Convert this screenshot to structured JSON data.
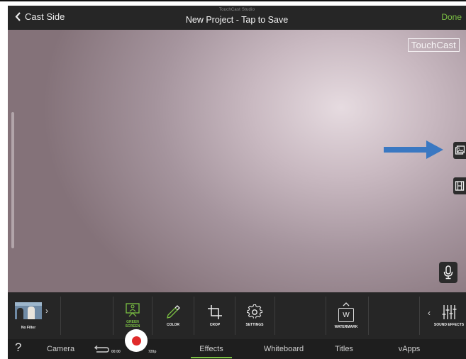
{
  "header": {
    "back_label": "Cast Side",
    "studio_label": "TouchCast Studio",
    "project_title": "New Project - Tap to Save",
    "done_label": "Done"
  },
  "canvas": {
    "logo_text": "TouchCast"
  },
  "effects_bar": {
    "filter_label": "No Filter",
    "green_screen_label": "GREEN\nSCREEN",
    "color_label": "COLOR",
    "crop_label": "CROP",
    "settings_label": "SETTINGS",
    "watermark_label": "WATERMARK",
    "watermark_glyph": "W",
    "sound_effects_label": "SOUND EFFECTS"
  },
  "bottom_bar": {
    "help_label": "?",
    "camera_label": "Camera",
    "timer": "00:00",
    "resolution": "720p",
    "tabs": [
      {
        "label": "Effects",
        "active": true
      },
      {
        "label": "Whiteboard",
        "active": false
      },
      {
        "label": "Titles",
        "active": false
      },
      {
        "label": "vApps",
        "active": false
      }
    ]
  },
  "colors": {
    "accent_green": "#7bc043",
    "record_red": "#e02a2a",
    "annotation_arrow": "#3a78c2"
  },
  "icons": [
    "chevron-left-icon",
    "image-icon",
    "film-icon",
    "microphone-icon",
    "green-screen-icon",
    "eyedropper-icon",
    "crop-icon",
    "gear-icon",
    "watermark-icon",
    "equalizer-icon",
    "undo-icon",
    "record-icon"
  ]
}
